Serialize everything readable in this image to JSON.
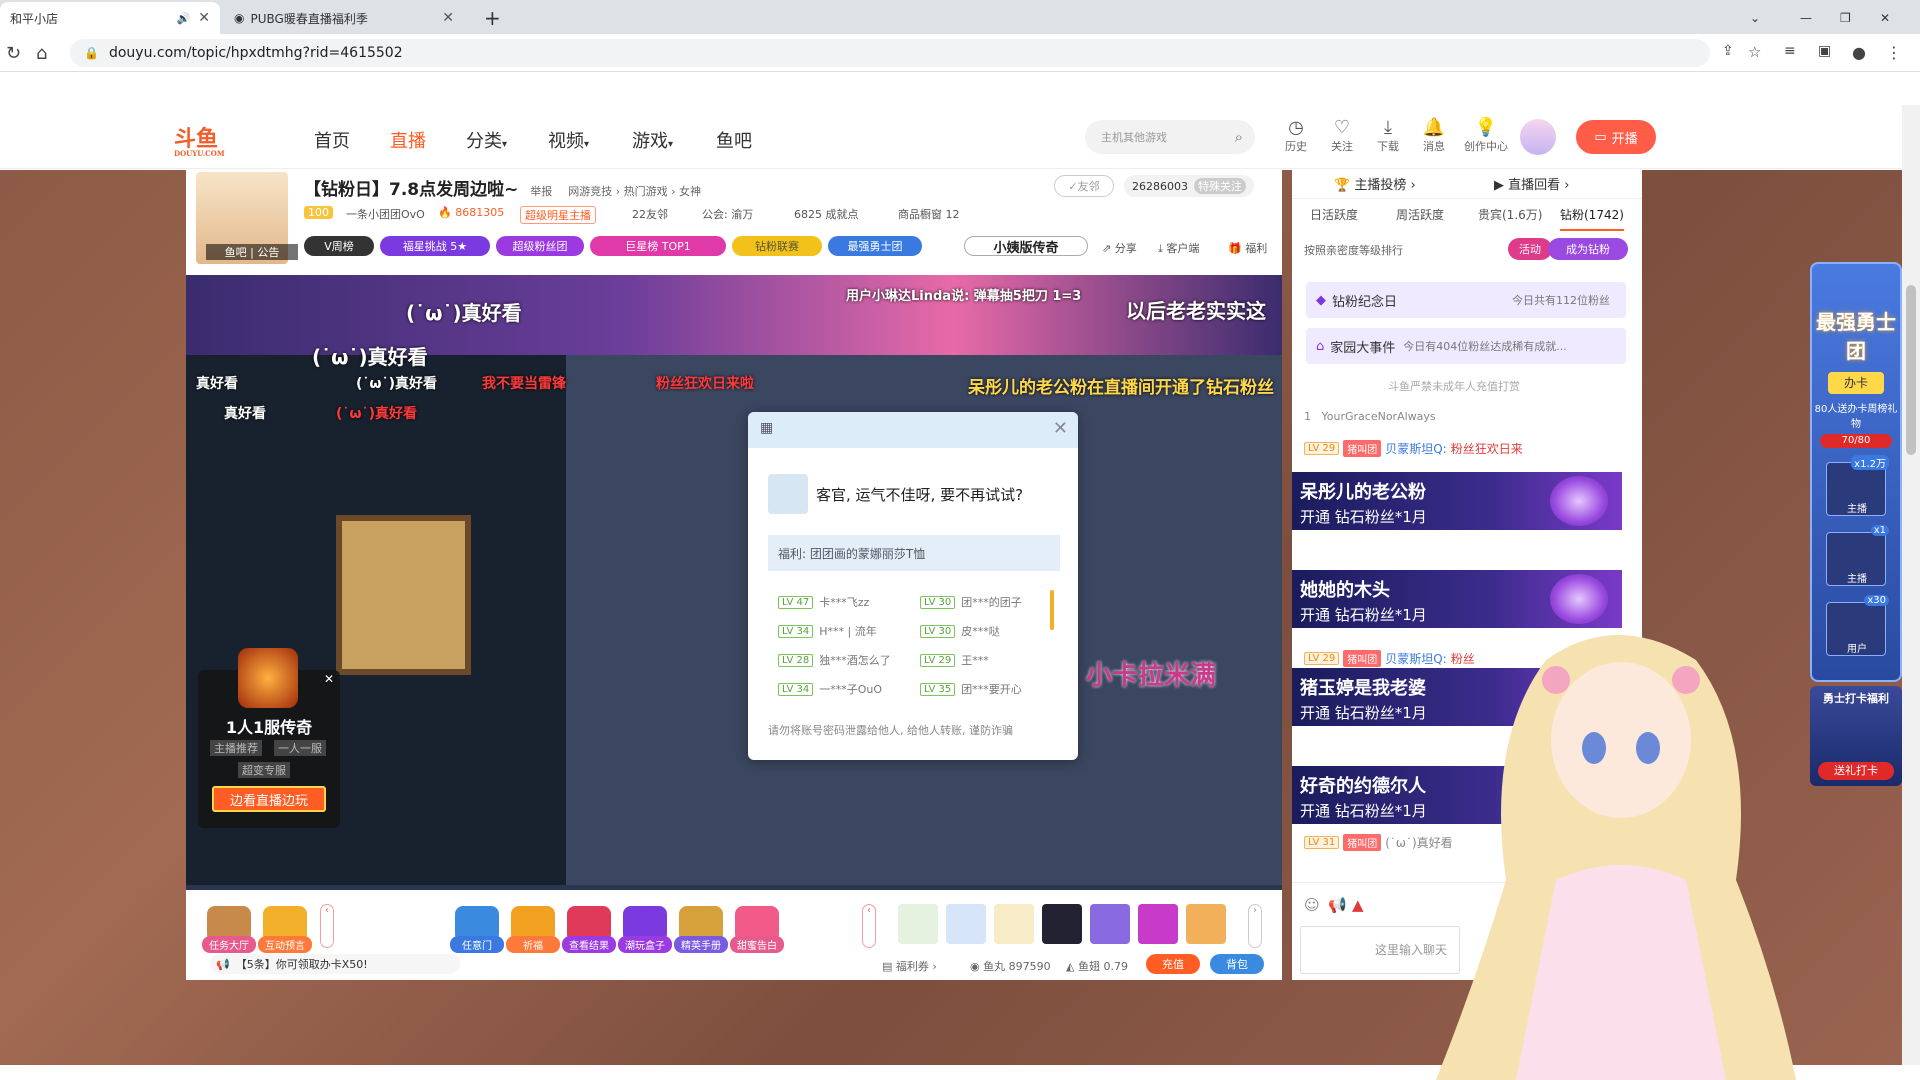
{
  "browser": {
    "tabs": [
      {
        "title": "和平小店",
        "active": true
      },
      {
        "title": "PUBG暖春直播福利季",
        "active": false
      }
    ],
    "url": "douyu.com/topic/hpxdtmhg?rid=4615502"
  },
  "site": {
    "logo": "斗鱼",
    "logo_sub": "DOUYU.COM",
    "nav": [
      "首页",
      "直播",
      "分类",
      "视频",
      "游戏",
      "鱼吧"
    ],
    "search_placeholder": "主机其他游戏",
    "header_icons": [
      "历史",
      "关注",
      "下载",
      "消息",
      "创作中心"
    ],
    "start_live": "开播"
  },
  "room": {
    "title": "【钻粉日】7.8点发周边啦~",
    "report": "举报",
    "category": "网游竞技 › 热门游戏 › 女神",
    "anchor_name": "一条小团团OvO",
    "hot": "8681305",
    "fan_badge": "超级明星主播",
    "fans": "22友邻",
    "union": "公会: 渝万",
    "achievements": "6825 成就点",
    "shop": "商品橱窗 12",
    "friend_btn": "友邻",
    "follow_count": "26286003",
    "follow_btn": "特殊关注",
    "avatar_label": "鱼吧 | 公告",
    "pills": [
      "V周榜",
      "福星挑战  5★",
      "超级粉丝团",
      "巨星榜 TOP1",
      "钻粉联赛",
      "最强勇士团"
    ],
    "share": "分享",
    "client": "客户端",
    "welfare": "福利",
    "game_banner": "小姨版传奇"
  },
  "video": {
    "banner_user": "用户小琳达Linda说: 弹幕抽5把刀  1=3",
    "banner_text": "以后老老实实这",
    "danmu": [
      "(˙ω˙)真好看",
      "(˙ω˙)真好看",
      "真好看",
      "(˙ω˙)真好看",
      "我不要当雷锋",
      "(˙ω˙)真好看",
      "呆彤儿的老公粉在直播间开通了钻石粉丝",
      "真好看",
      "粉丝狂欢日来啦"
    ],
    "sticker": "小卡拉米满",
    "ad": {
      "title": "1人1服传奇",
      "tags": [
        "主播推荐",
        "一人一服"
      ],
      "sub": "超变专服",
      "button": "边看直播边玩"
    }
  },
  "popup": {
    "title": "客官, 运气不佳呀, 要不再试试?",
    "prize": "福利: 团团画的蒙娜丽莎T恤",
    "winners": [
      [
        "LV 47",
        "卡***飞zz",
        "LV 30",
        "团***的团子"
      ],
      [
        "LV 34",
        "H*** | 流年",
        "LV 30",
        "皮***哒"
      ],
      [
        "LV 28",
        "独***酒怎么了",
        "LV 29",
        "王***"
      ],
      [
        "LV 34",
        "一***子OuO",
        "LV 35",
        "团***要开心"
      ]
    ],
    "warning": "请勿将账号密码泄露给他人, 给他人转账, 谨防诈骗"
  },
  "toolbar": {
    "tools": [
      "任务大厅",
      "互动预言",
      "任意门",
      "祈福",
      "查看结果",
      "潮玩盒子",
      "精英手册",
      "甜蜜告白"
    ],
    "notice": "【5条】你可领取办卡X50!",
    "coupon": "福利券",
    "fish_ball": "鱼丸 897590",
    "fish_wing": "鱼翅 0.79",
    "recharge": "充值",
    "backpack": "背包"
  },
  "sidebar": {
    "top_links": [
      "主播投榜",
      "直播回看"
    ],
    "tabs": [
      "日活跃度",
      "周活跃度",
      "贵宾(1.6万)",
      "钻粉(1742)"
    ],
    "sort_text": "按照亲密度等级排行",
    "activity_btn": "活动",
    "become_diamond": "成为钻粉",
    "diamond_day": "钻粉纪念日",
    "diamond_day_info": "今日共有112位粉丝",
    "family_event": "家园大事件",
    "family_event_info": "今日有404位粉丝达成稀有成就...",
    "minor_notice": "斗鱼严禁未成年人充值打赏",
    "rank_user": "YourGraceNorAlways",
    "chat_lines": [
      {
        "lv": "LV 29",
        "badge": "猪叫团",
        "name": "贝蒙斯坦Q:",
        "text": "粉丝狂欢日来"
      },
      {
        "lv": "LV 29",
        "badge": "猪叫团",
        "name": "贝蒙斯坦Q:",
        "text": "粉丝"
      },
      {
        "lv": "LV 31",
        "badge": "猪叫团",
        "name": "",
        "text": "(˙ω˙)真好看"
      }
    ],
    "gifts": [
      {
        "name": "呆彤儿的老公粉",
        "sub": "开通  钻石粉丝*1月"
      },
      {
        "name": "她她的木头",
        "sub": "开通  钻石粉丝*1月"
      },
      {
        "name": "猪玉婷是我老婆",
        "sub": "开通  钻石粉丝*1月"
      },
      {
        "name": "好奇的约德尔人",
        "sub": "开通  钻石粉丝*1月"
      }
    ],
    "input_placeholder": "这里输入聊天"
  },
  "rightfloat": {
    "title": "最强勇士团",
    "card": "办卡",
    "gift_note": "80人送办卡周榜礼物",
    "progress": "70/80",
    "items": [
      "主播",
      "主播",
      "用户"
    ],
    "multipliers": [
      "x1.2万",
      "x1",
      "x30"
    ],
    "checkin": "勇士打卡福利",
    "checkin_btn": "送礼打卡"
  }
}
